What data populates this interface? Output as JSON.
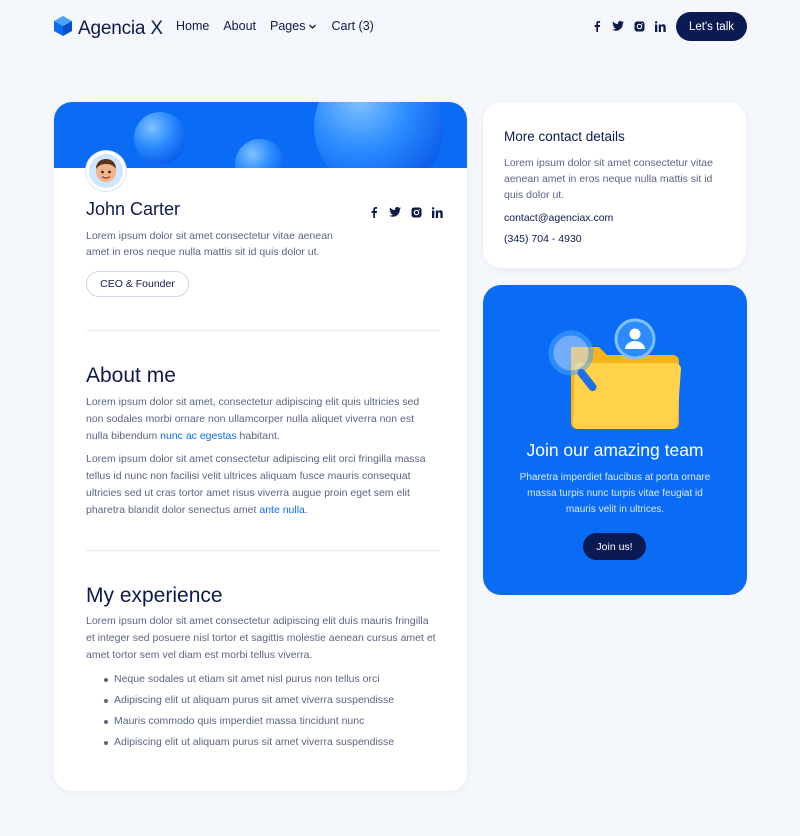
{
  "header": {
    "brand": "Agencia X",
    "nav": [
      {
        "label": "Home"
      },
      {
        "label": "About"
      },
      {
        "label": "Pages"
      },
      {
        "label": "Cart (3)"
      }
    ],
    "cta_label": "Let's talk",
    "socials": [
      "facebook-icon",
      "twitter-icon",
      "instagram-icon",
      "linkedin-icon"
    ]
  },
  "profile": {
    "name": "John Carter",
    "bio": "Lorem ipsum dolor sit amet consectetur vitae aenean amet in eros neque nulla mattis sit id quis dolor ut.",
    "role": "CEO & Founder"
  },
  "about": {
    "title": "About me",
    "p1_text": "Lorem ipsum dolor sit amet, consectetur adipiscing elit quis ultricies sed non sodales morbi ornare non ullamcorper nulla aliquet viverra non est nulla bibendum ",
    "p1_link": "nunc ac egestas",
    "p1_tail": " habitant.",
    "p2_text": "Lorem ipsum dolor sit amet consectetur adipiscing elit orci fringilla massa tellus id nunc non facilisi velit ultrices aliquam fusce mauris consequat ultricies sed ut cras tortor amet risus viverra augue proin eget sem elit pharetra blandit dolor senectus amet ",
    "p2_link": "ante nulla."
  },
  "experience": {
    "title": "My experience",
    "text": "Lorem ipsum dolor sit amet consectetur adipiscing elit duis mauris fringilla et integer sed posuere nisl tortor et sagittis molestie aenean cursus amet et amet tortor sem vel diam est morbi tellus viverra.",
    "items": [
      "Neque sodales ut etiam sit amet nisl purus non tellus orci",
      "Adipiscing elit ut aliquam purus sit amet viverra suspendisse",
      "Mauris commodo quis imperdiet massa tincidunt nunc",
      "Adipiscing elit ut aliquam purus sit amet viverra suspendisse"
    ]
  },
  "contact": {
    "title": "More contact details",
    "text": "Lorem ipsum dolor sit amet consectetur vitae aenean amet in eros neque nulla mattis sit id quis dolor ut.",
    "email": "contact@agenciax.com",
    "phone": "(345) 704 - 4930"
  },
  "join": {
    "title": "Join our amazing team",
    "text": "Pharetra imperdiet faucibus at porta ornare massa turpis nunc turpis vitae feugiat id mauris velit in ultrices.",
    "button_label": "Join us!"
  },
  "colors": {
    "accent": "#0a6cf5",
    "navy": "#0b1a52",
    "background": "#f4f7fc"
  }
}
